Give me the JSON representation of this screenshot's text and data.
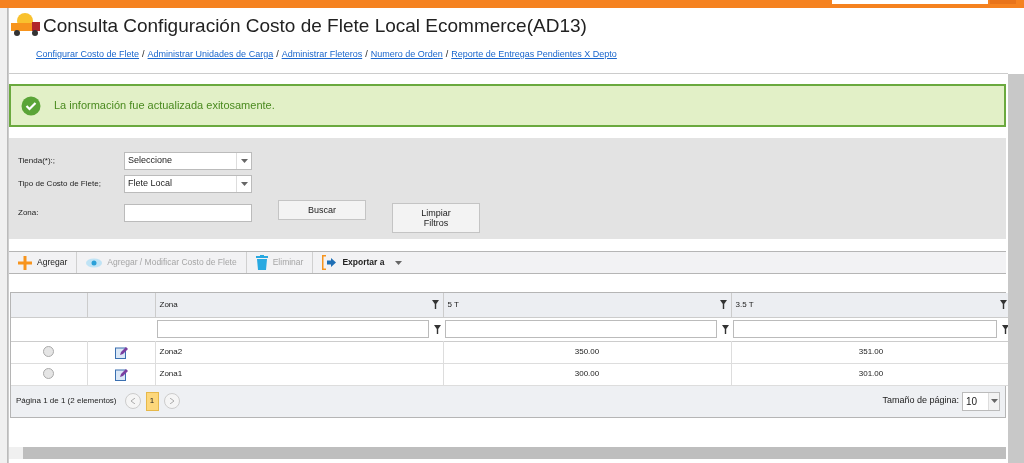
{
  "header": {
    "title": "Consulta Configuración Costo de Flete Local Ecommerce(AD13)",
    "separator": "/",
    "links": [
      "Configurar Costo de Flete",
      "Administrar Unidades de Carga",
      "Administrar Fleteros",
      "Numero de Orden",
      "Reporte de Entregas Pendientes X Depto"
    ]
  },
  "message": {
    "kind": "success",
    "text": "La información fue actualizada exitosamente."
  },
  "filters": {
    "fields": [
      {
        "label": "Tienda(*):;",
        "kind": "select",
        "value": "Seleccione"
      },
      {
        "label": "Tipo de Costo de Flete;",
        "kind": "select",
        "value": "Flete Local"
      },
      {
        "label": "Zona:",
        "kind": "text"
      }
    ],
    "buttons": [
      "Buscar",
      "Limpiar Filtros"
    ]
  },
  "toolbar": [
    {
      "label": "Agregar",
      "kind": "add",
      "disabled": false
    },
    {
      "label": "Agregar / Modificar Costo de Flete",
      "kind": "view",
      "disabled": true
    },
    {
      "label": "Eliminar",
      "kind": "delete",
      "disabled": true
    },
    {
      "label": "Exportar a",
      "kind": "export",
      "disabled": false
    }
  ],
  "grid": {
    "columns": [
      "Zona",
      "5 T",
      "3.5 T"
    ],
    "rows": [
      {
        "selected": false,
        "cells": [
          "Zona2",
          "350.00",
          "351.00"
        ]
      },
      {
        "selected": false,
        "cells": [
          "Zona1",
          "300.00",
          "301.00"
        ]
      }
    ]
  },
  "pager": {
    "info": "Página 1 de 1 (2 elementos)",
    "pages": [
      {
        "label": "1",
        "selected": true
      }
    ],
    "page_size_label": "Tamaño de página:",
    "page_size": "10"
  }
}
